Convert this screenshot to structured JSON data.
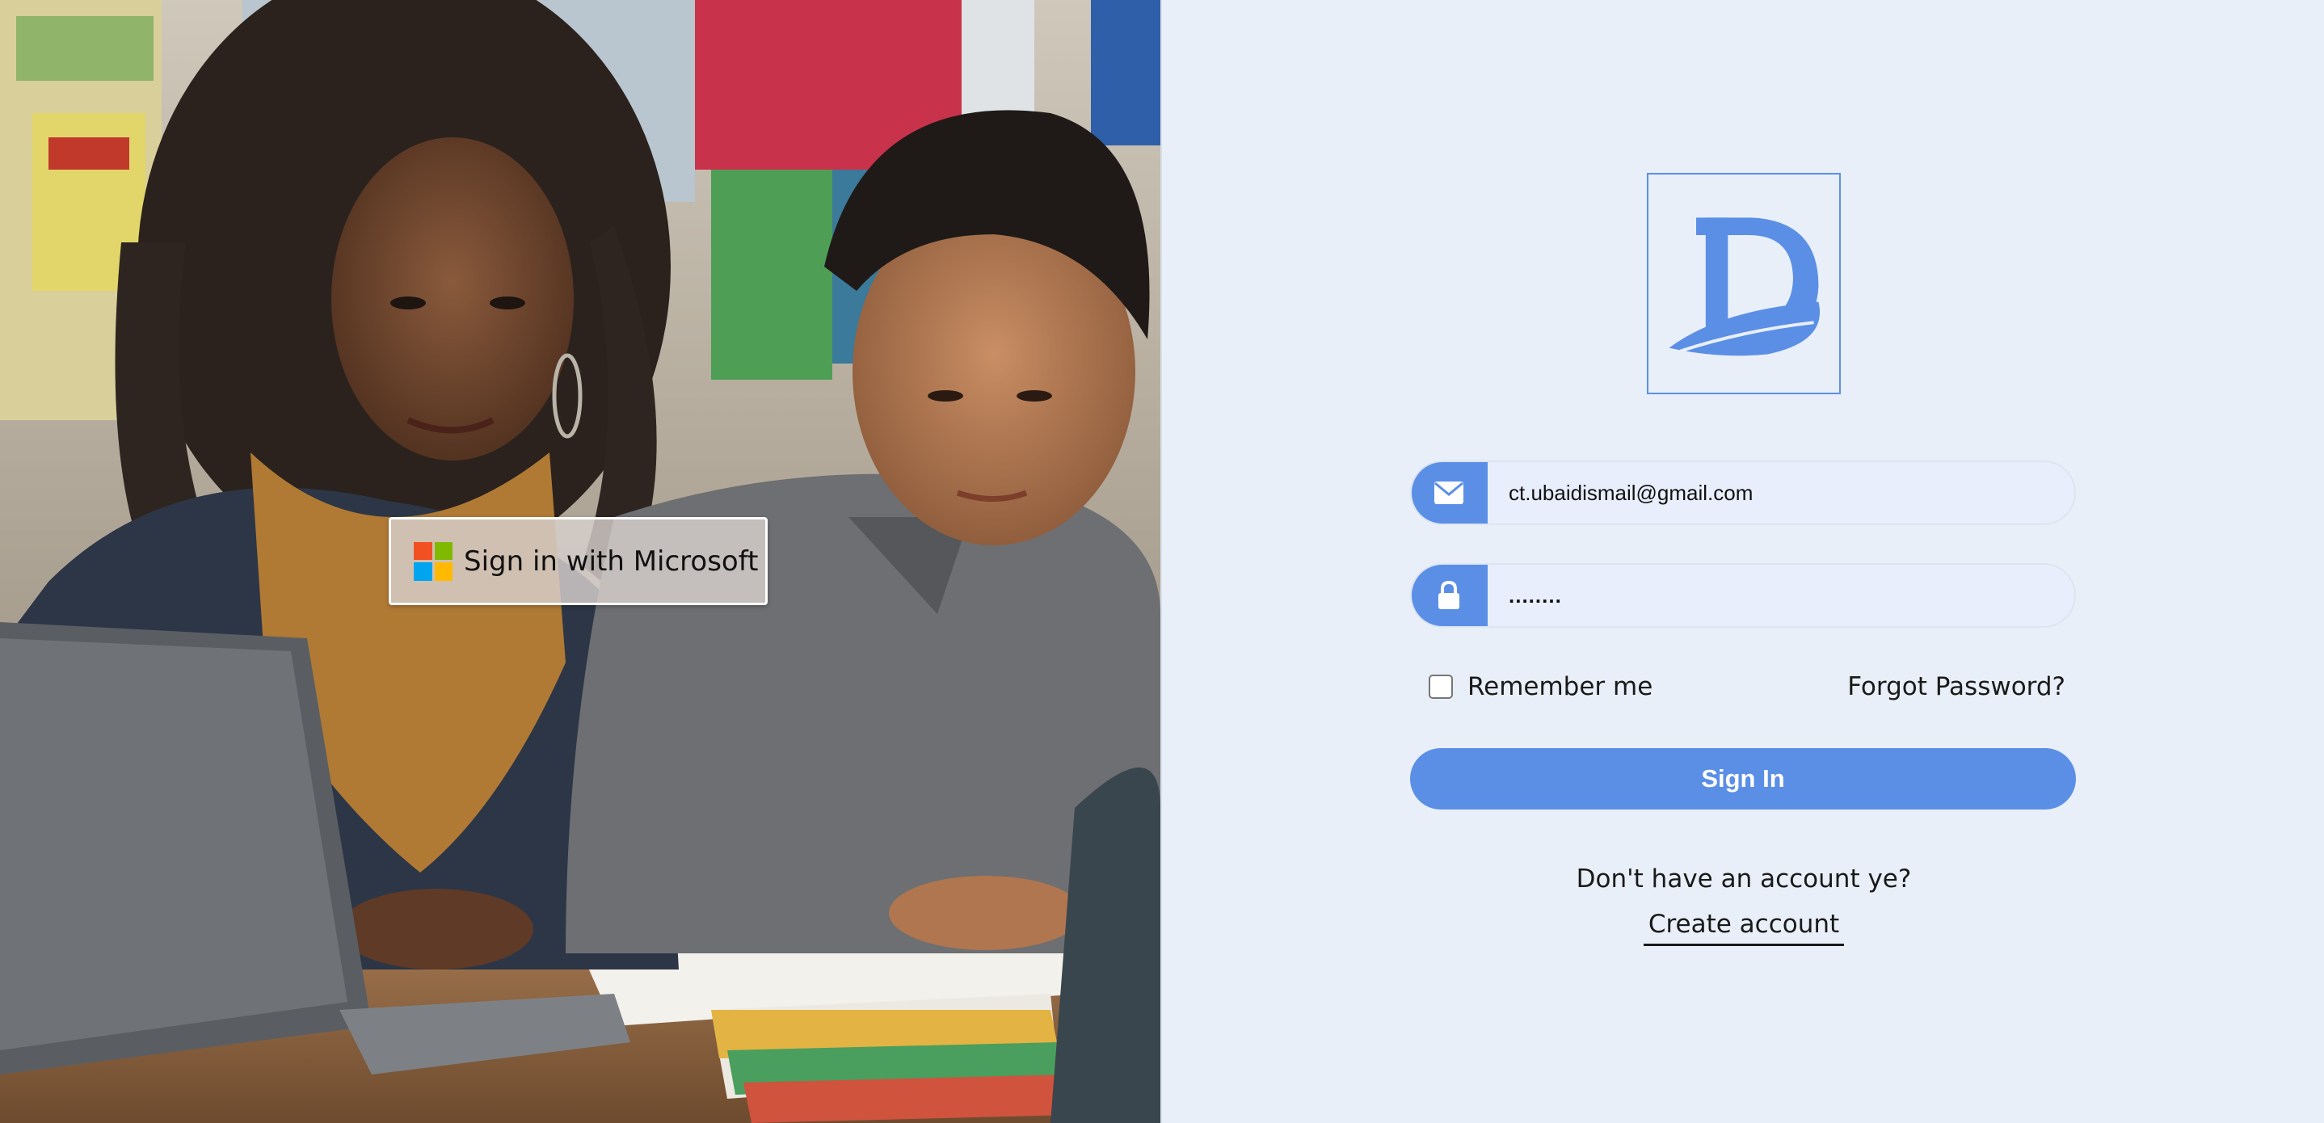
{
  "hero": {
    "description_icon": "classroom-photo",
    "microsoft_button": {
      "label": "Sign in with Microsoft",
      "icon": "microsoft-logo-icon",
      "logo_colors": [
        "#f25022",
        "#7fba00",
        "#00a4ef",
        "#ffb900"
      ]
    }
  },
  "login": {
    "brand_logo_icon": "d-logo-icon",
    "email": {
      "icon": "envelope-icon",
      "value": "ct.ubaidismail@gmail.com"
    },
    "password": {
      "icon": "lock-icon",
      "value": "........"
    },
    "remember_label": "Remember me",
    "remember_checked": false,
    "forgot_label": "Forgot Password?",
    "signin_label": "Sign In",
    "no_account_text": "Don't have an account ye?",
    "create_account_label": "Create account"
  },
  "colors": {
    "accent": "#5b8fe6",
    "panel_background": "#e9eff8",
    "text": "#1a1a1a"
  }
}
